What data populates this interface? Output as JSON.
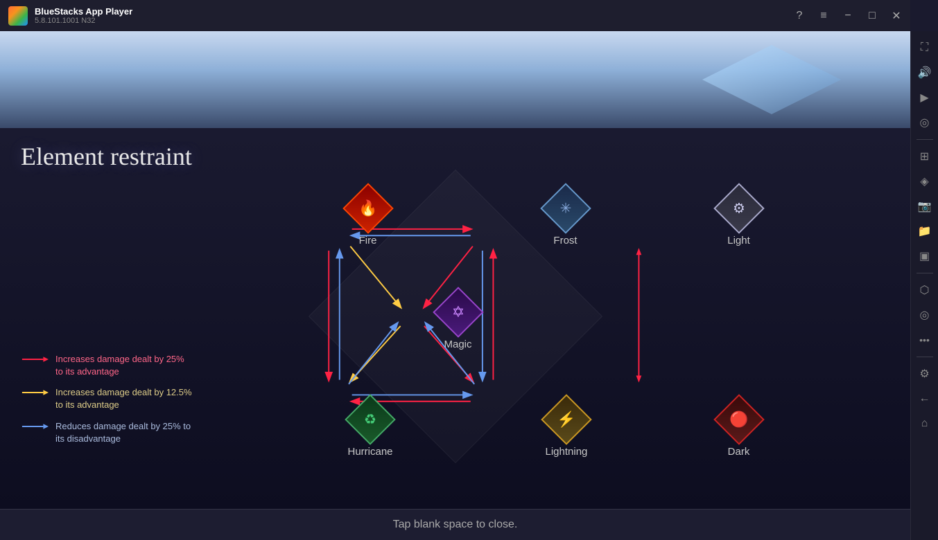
{
  "titlebar": {
    "app_name": "BlueStacks App Player",
    "version": "5.8.101.1001  N32",
    "buttons": {
      "help": "?",
      "menu": "≡",
      "minimize": "−",
      "maximize": "□",
      "close": "✕"
    }
  },
  "sidebar": {
    "icons": [
      "⛶",
      "↩",
      "⏺",
      "◎",
      "⊞",
      "◈",
      "▣",
      "⬡",
      "◎",
      "✦",
      "⚙",
      "←",
      "⌂"
    ]
  },
  "page": {
    "title": "Element restraint",
    "bottom_text": "Tap blank space to close."
  },
  "elements": {
    "fire": {
      "label": "Fire",
      "emoji": "🔥"
    },
    "frost": {
      "label": "Frost",
      "emoji": "❄"
    },
    "light": {
      "label": "Light",
      "emoji": "✦"
    },
    "magic": {
      "label": "Magic",
      "emoji": "✡"
    },
    "hurricane": {
      "label": "Hurricane",
      "emoji": "🌀"
    },
    "lightning": {
      "label": "Lightning",
      "emoji": "⚡"
    },
    "dark": {
      "label": "Dark",
      "emoji": "🔴"
    }
  },
  "legend": {
    "items": [
      {
        "color": "#ff3355",
        "text": "Increases damage dealt by 25% to its advantage"
      },
      {
        "color": "#ffcc44",
        "text": "Increases damage dealt by 12.5% to its advantage"
      },
      {
        "color": "#6699ee",
        "text": "Reduces damage dealt by 25% to its disadvantage"
      }
    ]
  }
}
